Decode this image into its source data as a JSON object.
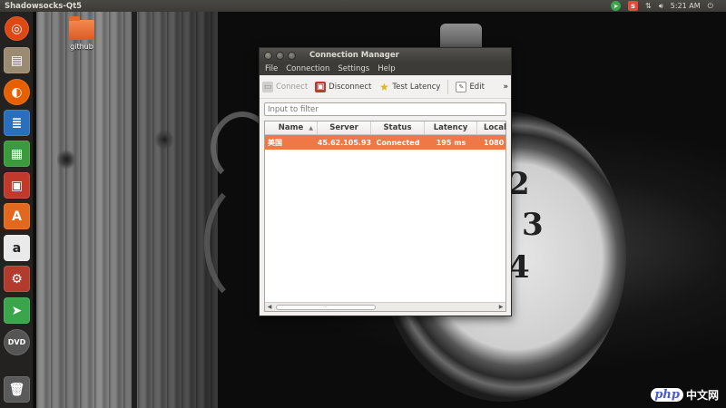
{
  "top_panel": {
    "app_title": "Shadowsocks-Qt5",
    "clock": "5:21 AM",
    "indicator_icons": [
      "telegram-icon",
      "shadowsocks-icon",
      "network-icon",
      "volume-icon",
      "power-icon"
    ]
  },
  "desktop": {
    "folder_label": "github"
  },
  "launcher": {
    "items": [
      {
        "name": "ubuntu-dash",
        "color": "#dd4814"
      },
      {
        "name": "files",
        "color": "#9b8b73"
      },
      {
        "name": "firefox",
        "color": "#e66000"
      },
      {
        "name": "libreoffice-writer",
        "color": "#2a6fbb"
      },
      {
        "name": "libreoffice-calc",
        "color": "#3b9a3b"
      },
      {
        "name": "libreoffice-impress",
        "color": "#c0392b"
      },
      {
        "name": "software-center",
        "color": "#e2681e"
      },
      {
        "name": "amazon",
        "color": "#eaeaea"
      },
      {
        "name": "system-settings",
        "color": "#b33b2e"
      },
      {
        "name": "telegram",
        "color": "#3aa54a"
      },
      {
        "name": "dvd",
        "color": "#555555"
      },
      {
        "name": "trash",
        "color": "#5a5a5a"
      }
    ]
  },
  "window": {
    "title": "Connection Manager",
    "menu": [
      "File",
      "Connection",
      "Settings",
      "Help"
    ],
    "toolbar": {
      "connect": "Connect",
      "disconnect": "Disconnect",
      "test_latency": "Test Latency",
      "edit": "Edit",
      "more": "»"
    },
    "filter_placeholder": "Input to filter",
    "table": {
      "headers": [
        "Name",
        "Server",
        "Status",
        "Latency",
        "Local"
      ],
      "rows": [
        {
          "name": "美国",
          "server": "45.62.105.93",
          "status": "Connected",
          "latency": "195 ms",
          "local": "1080"
        }
      ]
    }
  },
  "watermark": {
    "logo": "php",
    "text": "中文网"
  },
  "colors": {
    "selected_row": "#f07746",
    "panel_bg": "#3c3b37",
    "window_bg": "#f2f1f0"
  }
}
